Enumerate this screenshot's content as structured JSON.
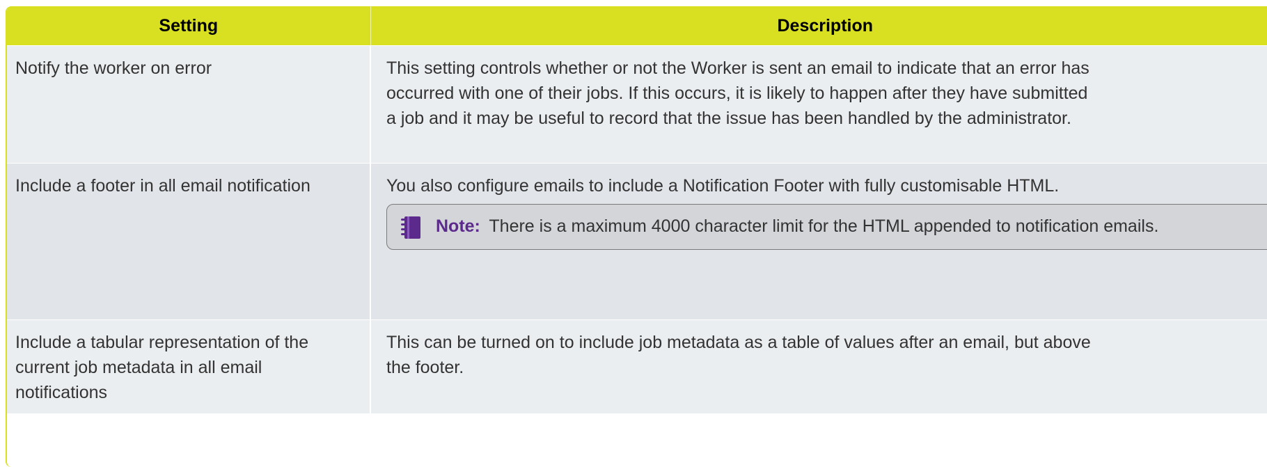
{
  "header": {
    "setting": "Setting",
    "description": "Description"
  },
  "rows": [
    {
      "setting": "Notify the worker on error",
      "description": "This setting controls whether or not the Worker is sent an email to indicate that an error has occurred with one of their jobs. If this occurs, it is likely to happen after they have submitted a job and it may be useful to record that the issue has been handled by the administrator."
    },
    {
      "setting": "Include a footer in all email notification",
      "description": "You also configure emails to include a Notification Footer with fully customisable HTML.",
      "note": {
        "label": "Note:",
        "text": "There is a maximum 4000 character limit for the HTML appended to notification emails.",
        "icon": "notebook-icon"
      }
    },
    {
      "setting": "Include a tabular representation of the current job metadata in all email notifications",
      "description": "This can be turned on to include job metadata as a table of values after an email, but above the footer."
    }
  ],
  "colors": {
    "header_bg": "#d9e021",
    "row_bg": "#ebeef0",
    "row_alt_bg": "#e1e4e8",
    "note_bg": "#d3d5d9",
    "note_label": "#5b2a8c"
  }
}
